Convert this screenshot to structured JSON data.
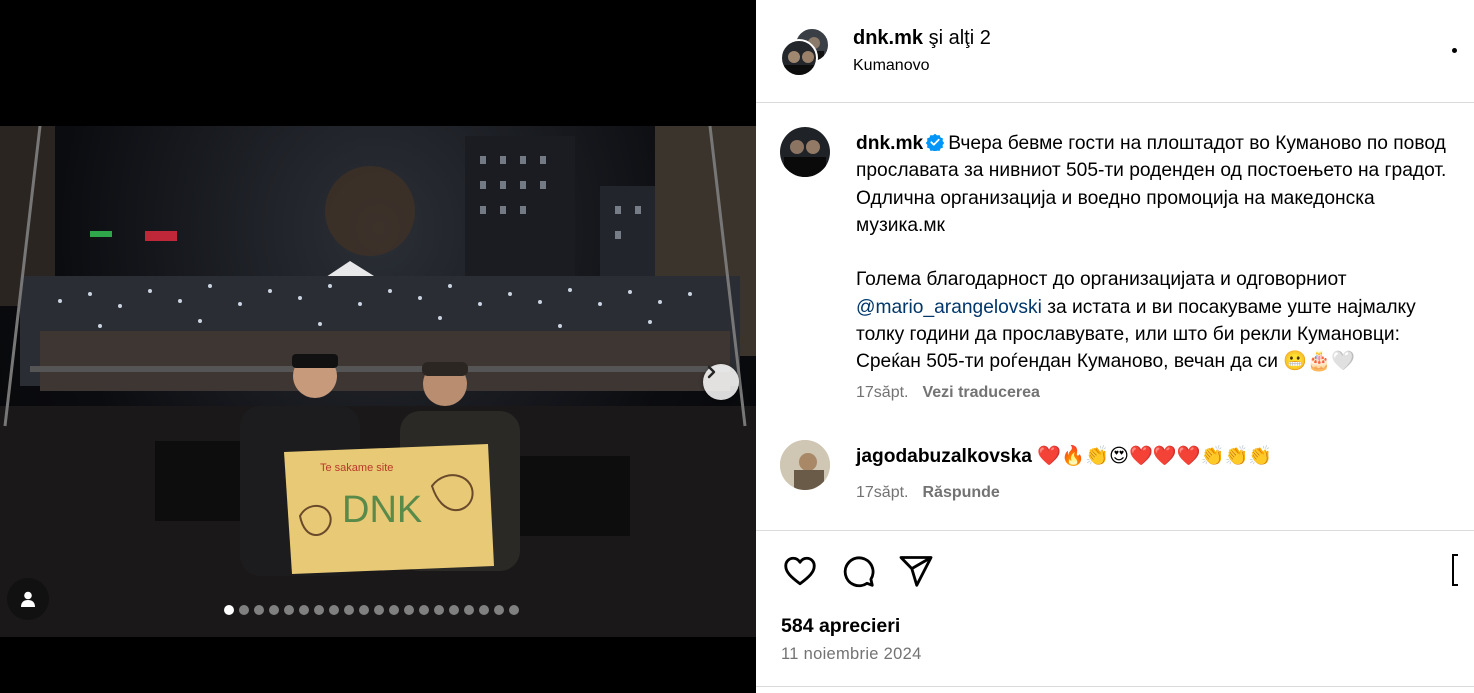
{
  "header": {
    "username": "dnk.mk",
    "coauthors": "şi alţi 2",
    "location": "Kumanovo"
  },
  "media": {
    "sign_text": "DNK",
    "sign_small_text": "Te sakame site",
    "carousel_total": 20,
    "carousel_active": 1
  },
  "caption": {
    "username": "dnk.mk",
    "line1": "Вчера бевме гости на плоштадот во Куманово по повод прославата за нивниот 505-ти роденден од постоењето на градот. Одлична организација и воедно промоција на македонска музика.мк",
    "line2_before": "Голема благодарност до организацијата и одговорниот ",
    "mention": "@mario_arangelovski",
    "line2_after": " за истата и ви посакуваме уште најмалку толку години да прославувате, или што би рекли Кумановци: Среќан 505-ти роѓендан Куманово, вечан да си 😬🎂🤍",
    "time": "17săpt.",
    "translate": "Vezi traducerea"
  },
  "comment": {
    "username": "jagodabuzalkovska",
    "text": "❤️🔥👏😍❤️❤️❤️👏👏👏",
    "time": "17săpt.",
    "reply": "Răspunde"
  },
  "footer": {
    "likes": "584 aprecieri",
    "date": "11 noiembrie 2024"
  },
  "icons": {
    "like": "heart-icon",
    "comment": "comment-icon",
    "share": "share-icon",
    "save": "bookmark-icon",
    "next": "chevron-right-icon",
    "tag": "user-tag-icon",
    "verified": "verified-badge-icon"
  },
  "colors": {
    "verified": "#0095f6",
    "mention": "#00376b",
    "muted": "#737373"
  }
}
